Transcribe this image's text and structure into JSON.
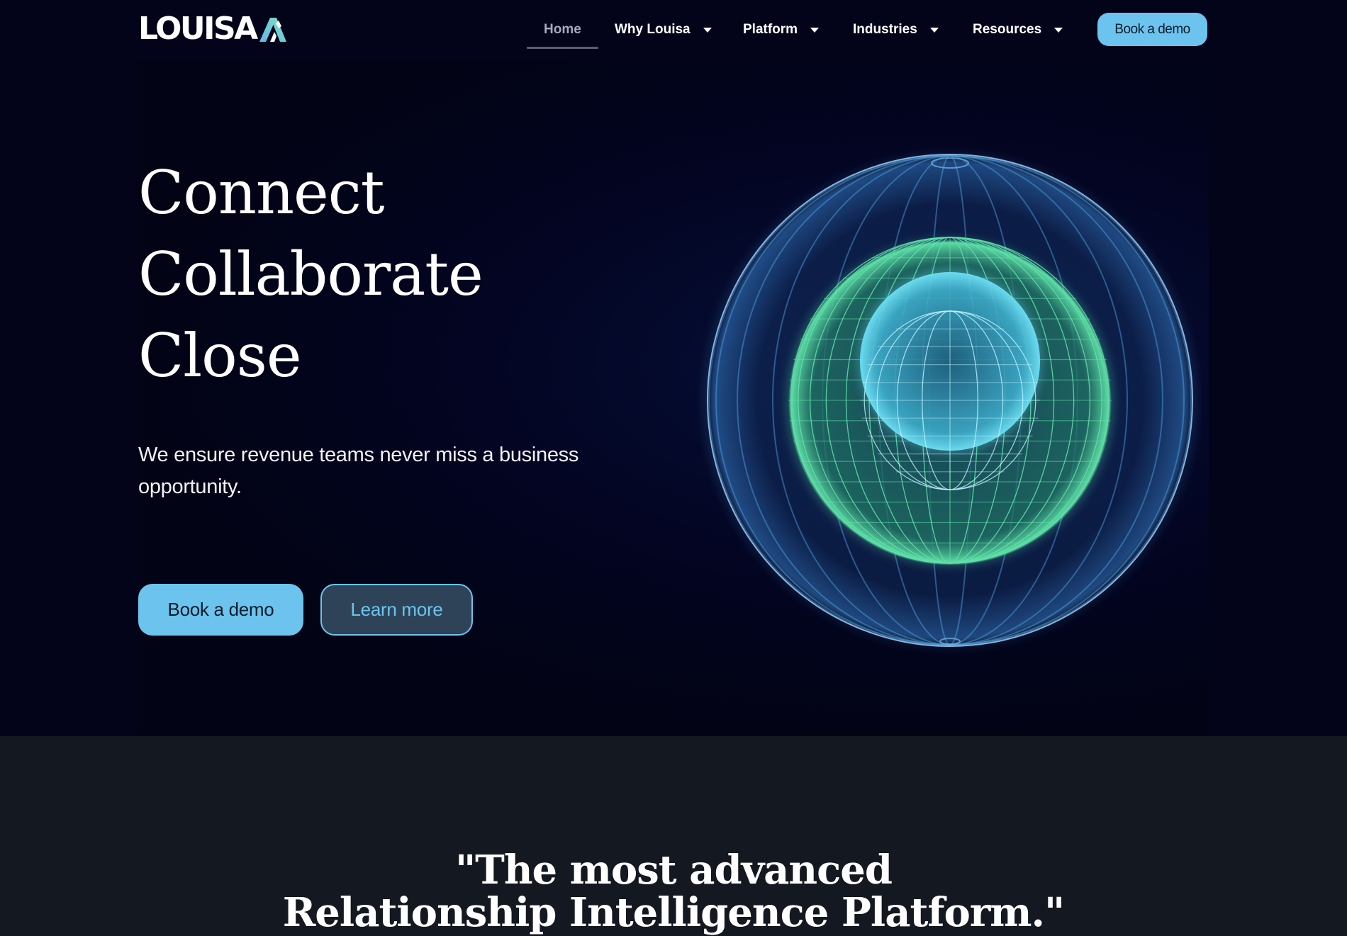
{
  "header": {
    "logo": {
      "text": "LOUISA",
      "mark_icon": "louisa-a-mark-icon"
    },
    "nav": [
      {
        "label": "Home",
        "active": true,
        "has_dropdown": false
      },
      {
        "label": "Why Louisa",
        "active": false,
        "has_dropdown": true
      },
      {
        "label": "Platform",
        "active": false,
        "has_dropdown": true
      },
      {
        "label": "Industries",
        "active": false,
        "has_dropdown": true
      },
      {
        "label": "Resources",
        "active": false,
        "has_dropdown": true
      }
    ],
    "cta_label": "Book a demo"
  },
  "hero": {
    "title_lines": [
      "Connect",
      "Collaborate",
      "Close"
    ],
    "subtitle": "We ensure revenue teams never miss a business opportunity.",
    "primary_button": "Book a demo",
    "secondary_button": "Learn more",
    "visual": "wireframe-sphere-animation"
  },
  "quote_section": {
    "lines": [
      "\"The most advanced",
      "Relationship Intelligence Platform.\""
    ]
  },
  "colors": {
    "background": "#03041a",
    "accent": "#6cc4ee",
    "secondary_button_bg": "#2e4358",
    "quote_section_bg": "#141820",
    "sphere_outer": "#4fa6e8",
    "sphere_middle": "#5fe3a8",
    "sphere_inner": "#6fe0f5"
  }
}
